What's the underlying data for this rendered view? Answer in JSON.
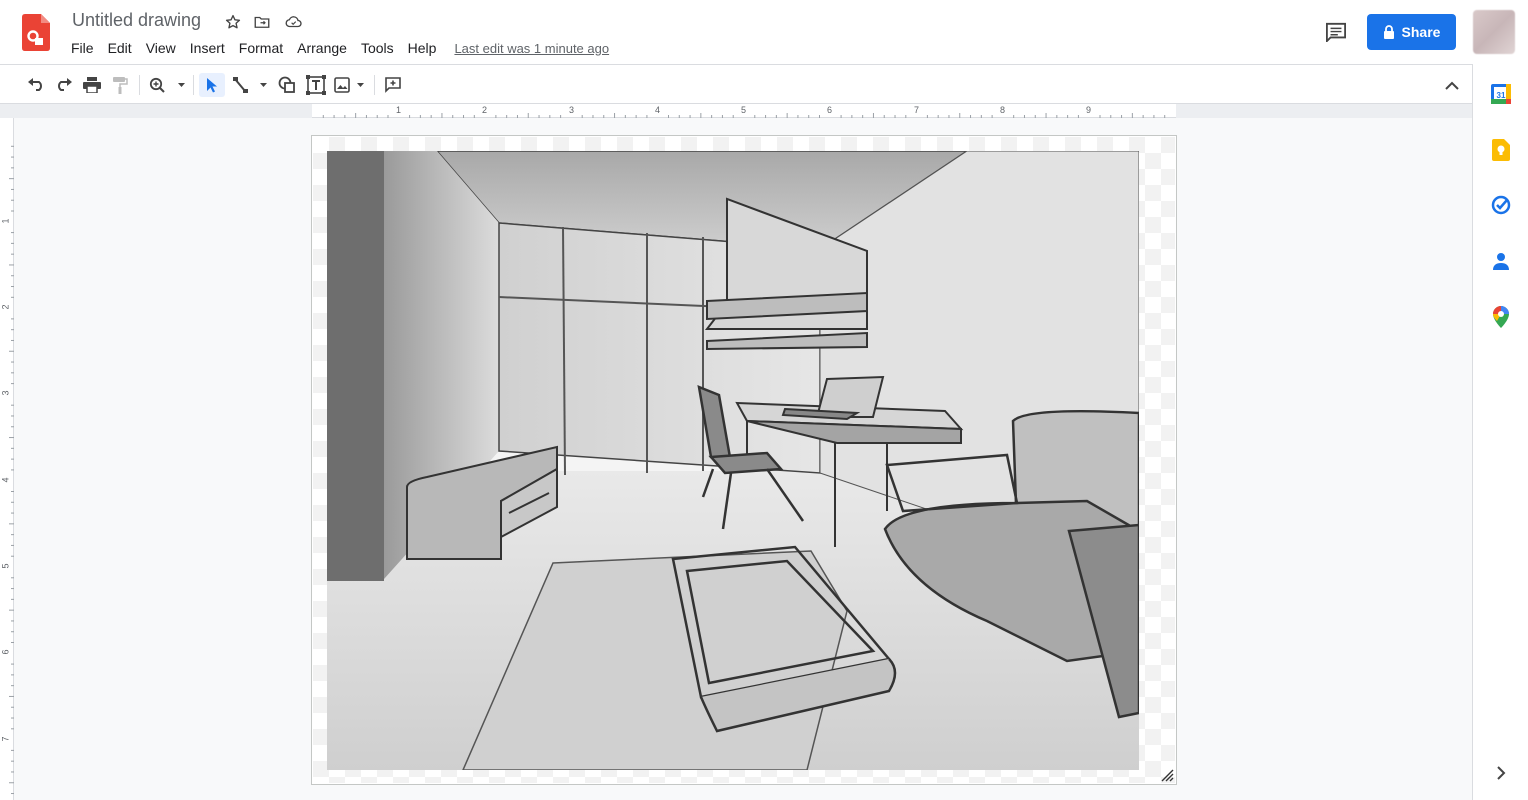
{
  "header": {
    "title": "Untitled drawing",
    "last_edit": "Last edit was 1 minute ago",
    "share_label": "Share",
    "icons": [
      "drawings-logo-icon",
      "star-icon",
      "move-folder-icon",
      "cloud-status-icon",
      "comments-icon",
      "lock-icon",
      "avatar"
    ]
  },
  "menu": [
    "File",
    "Edit",
    "View",
    "Insert",
    "Format",
    "Arrange",
    "Tools",
    "Help"
  ],
  "toolbar": {
    "tools": [
      "undo-icon",
      "redo-icon",
      "print-icon",
      "paint-format-icon",
      "zoom-icon",
      "select-icon",
      "line-icon",
      "shape-icon",
      "text-box-icon",
      "image-icon",
      "comment-add-icon",
      "collapse-icon"
    ],
    "active_tool": "select"
  },
  "ruler": {
    "horizontal_numbers": [
      "1",
      "2",
      "3",
      "4",
      "5",
      "6",
      "7",
      "8",
      "9"
    ],
    "vertical_numbers": [
      "1",
      "2",
      "3",
      "4",
      "5",
      "6",
      "7"
    ]
  },
  "side_panel": {
    "apps": [
      "calendar-icon",
      "keep-icon",
      "tasks-icon",
      "contacts-icon",
      "maps-icon",
      "expand-panel-icon"
    ],
    "calendar_day": "31"
  },
  "canvas": {
    "image_subject": "pencil-sketch-room-interior"
  },
  "colors": {
    "accent": "#1a73e8",
    "logo": "#ea4335"
  }
}
